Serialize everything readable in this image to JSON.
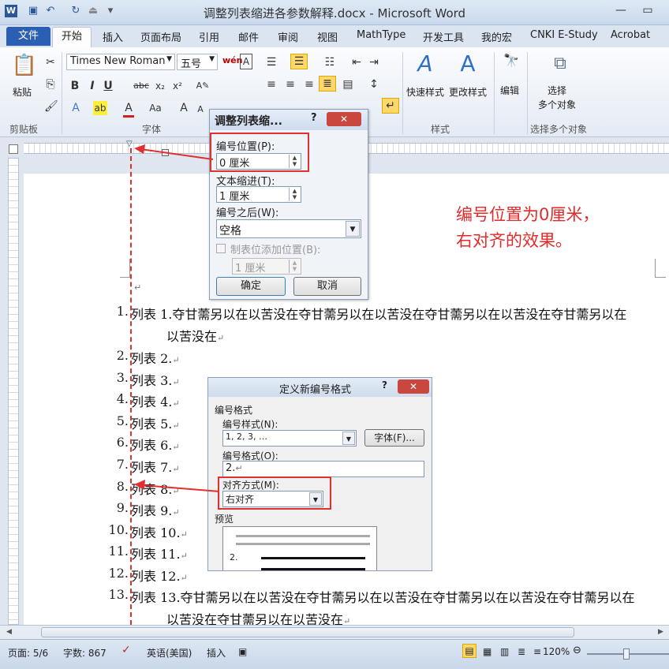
{
  "window": {
    "title": "调整列表缩进各参数解释.docx - Microsoft Word",
    "qat_icons": [
      "word-app-icon",
      "save-icon",
      "undo-icon",
      "redo-icon",
      "customize-qat-icon"
    ]
  },
  "tabs": [
    "文件",
    "开始",
    "插入",
    "页面布局",
    "引用",
    "邮件",
    "审阅",
    "视图",
    "MathType",
    "开发工具",
    "我的宏",
    "CNKI E-Study",
    "Acrobat"
  ],
  "ribbon": {
    "clipboard": {
      "paste": "粘贴",
      "label": "剪贴板"
    },
    "font": {
      "name": "Times New Roman",
      "size": "五号",
      "label": "字体"
    },
    "styles": {
      "quick": "快速样式",
      "change": "更改样式",
      "label": "样式"
    },
    "editing": {
      "edit": "编辑"
    },
    "select_multi": {
      "button": "选择\n多个对象",
      "label": "选择多个对象"
    }
  },
  "dialog1": {
    "title": "调整列表缩...",
    "number_position_label": "编号位置(P):",
    "number_position_value": "0 厘米",
    "text_indent_label": "文本缩进(T):",
    "text_indent_value": "1 厘米",
    "after_number_label": "编号之后(W):",
    "after_number_value": "空格",
    "add_tab_label": "制表位添加位置(B):",
    "add_tab_value": "1 厘米",
    "ok": "确定",
    "cancel": "取消"
  },
  "dialog2": {
    "title": "定义新编号格式",
    "section": "编号格式",
    "style_label": "编号样式(N):",
    "style_value": "1, 2, 3, …",
    "font_button": "字体(F)...",
    "format_label": "编号格式(O):",
    "format_value": "2.",
    "align_label": "对齐方式(M):",
    "align_value": "右对齐",
    "preview_label": "预览",
    "preview_num": "2."
  },
  "annotation": {
    "line1": "编号位置为0厘米，",
    "line2": "右对齐的效果。"
  },
  "list": [
    {
      "num": "1.",
      "text": "列表 1.夺甘薷另以在以苦没在夺甘薷另以在以苦没在夺甘薷另以在以苦没在夺甘薷另以在",
      "cont": "以苦没在"
    },
    {
      "num": "2.",
      "text": "列表 2."
    },
    {
      "num": "3.",
      "text": "列表 3."
    },
    {
      "num": "4.",
      "text": "列表 4."
    },
    {
      "num": "5.",
      "text": "列表 5."
    },
    {
      "num": "6.",
      "text": "列表 6."
    },
    {
      "num": "7.",
      "text": "列表 7."
    },
    {
      "num": "8.",
      "text": "列表 8."
    },
    {
      "num": "9.",
      "text": "列表 9."
    },
    {
      "num": "10.",
      "text": "列表 10."
    },
    {
      "num": "11.",
      "text": "列表 11."
    },
    {
      "num": "12.",
      "text": "列表 12."
    },
    {
      "num": "13.",
      "text": "列表 13.夺甘薷另以在以苦没在夺甘薷另以在以苦没在夺甘薷另以在以苦没在夺甘薷另以在",
      "cont": "以苦没在夺甘薷另以在以苦没在"
    }
  ],
  "status": {
    "page": "页面: 5/6",
    "words": "字数: 867",
    "language": "英语(美国)",
    "mode": "插入",
    "zoom": "120%"
  },
  "colors": {
    "accent": "#2b5fb4",
    "annotation": "#e32a2a"
  }
}
